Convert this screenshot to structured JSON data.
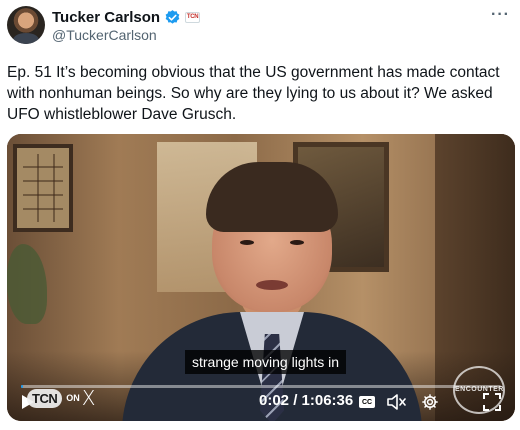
{
  "author": {
    "display_name": "Tucker Carlson",
    "handle": "@TuckerCarlson",
    "verified": true,
    "affiliate_badge": "TCN"
  },
  "tweet": {
    "text": "Ep. 51  It’s becoming obvious that the US government has made contact with nonhuman beings. So why are they lying to us about it? We asked UFO whistleblower Dave Grusch."
  },
  "video": {
    "caption": "strange moving lights in",
    "current_time": "0:02",
    "duration": "1:06:36",
    "time_display": "0:02 / 1:06:36",
    "progress_percent": 0.05,
    "logo_text": "TCN",
    "logo_on": "ON",
    "logo_x": "X",
    "watermark": "THE TUCKER CARLSON ENCOUNTER"
  },
  "icons": {
    "more": "more-dots-icon",
    "play": "play-icon",
    "captions": "captions-icon",
    "mute": "volume-muted-icon",
    "settings": "gear-icon",
    "fullscreen": "fullscreen-icon"
  },
  "colors": {
    "accent": "#1d9bf0",
    "text_primary": "#0f1419",
    "text_secondary": "#536471"
  }
}
